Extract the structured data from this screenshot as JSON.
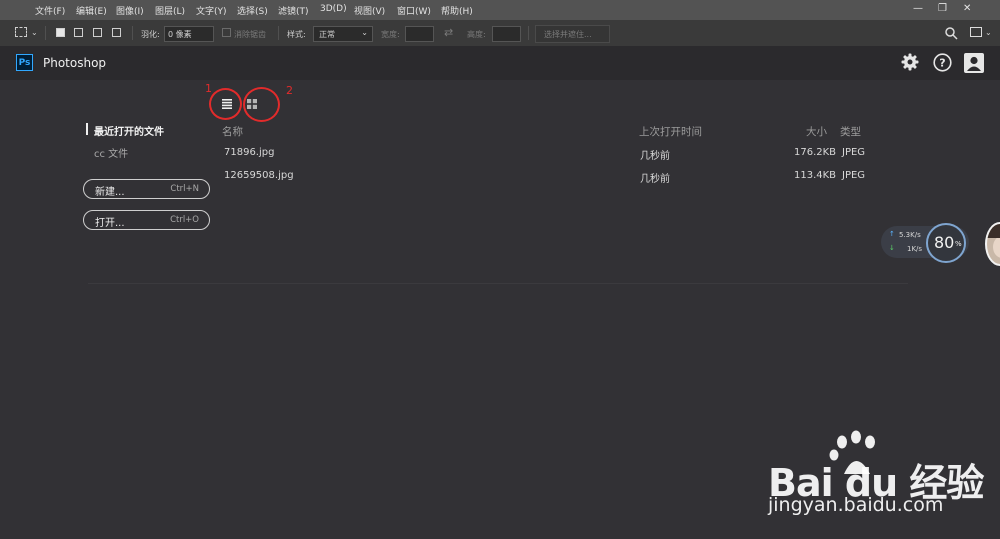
{
  "menubar": {
    "items": [
      "文件(F)",
      "编辑(E)",
      "图像(I)",
      "图层(L)",
      "文字(Y)",
      "选择(S)",
      "滤镜(T)",
      "3D(D)",
      "视图(V)",
      "窗口(W)",
      "帮助(H)"
    ],
    "minimize": "—",
    "restore": "❐",
    "close": "✕"
  },
  "options": {
    "feather_label": "羽化:",
    "feather_value": "0 像素",
    "antialias_label": "消除锯齿",
    "style_label": "样式:",
    "style_value": "正常",
    "width_label": "宽度:",
    "height_label": "高度:",
    "select_mask_label": "选择并遮住..."
  },
  "header": {
    "logo": "Ps",
    "title": "Photoshop"
  },
  "sidebar": {
    "recent_label": "最近打开的文件",
    "cc_label": "cc 文件",
    "new_label": "新建...",
    "new_shortcut": "Ctrl+N",
    "open_label": "打开...",
    "open_shortcut": "Ctrl+O"
  },
  "annotations": {
    "one": "1",
    "two": "2"
  },
  "table": {
    "headers": {
      "name": "名称",
      "opened": "上次打开时间",
      "size": "大小",
      "type": "类型"
    },
    "rows": [
      {
        "name": "71896.jpg",
        "opened": "几秒前",
        "size": "176.2KB",
        "type": "JPEG"
      },
      {
        "name": "12659508.jpg",
        "opened": "几秒前",
        "size": "113.4KB",
        "type": "JPEG"
      }
    ]
  },
  "speed_widget": {
    "up": "5.3K/s",
    "down": "1K/s",
    "percent": "80",
    "percent_unit": "%"
  },
  "watermark": {
    "brand": "Bai du 经验",
    "url": "jingyan.baidu.com"
  },
  "colors": {
    "accent_ps": "#31a8ff",
    "annotation": "#e22b2b",
    "background": "#323135"
  }
}
